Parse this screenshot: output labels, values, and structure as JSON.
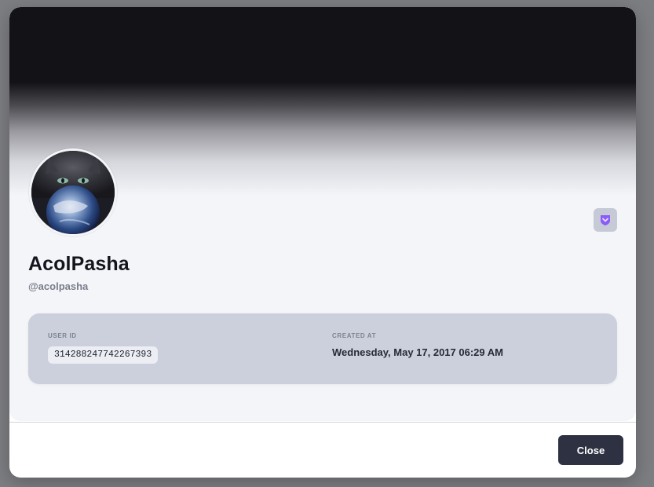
{
  "profile": {
    "display_name": "AcolPasha",
    "handle": "@acolpasha",
    "avatar_icon": "cat-globe-avatar",
    "badge_icon": "shield-chevron-icon"
  },
  "details": {
    "user_id_label": "USER ID",
    "user_id_value": "314288247742267393",
    "created_label": "CREATED AT",
    "created_value": "Wednesday, May 17, 2017 06:29 AM"
  },
  "footer": {
    "close_label": "Close"
  },
  "colors": {
    "overlay": "#7d7e82",
    "card_background": "#f4f5f9",
    "banner_dark": "#131317",
    "info_panel": "#cbd0dc",
    "badge_background": "#c6c9d6",
    "badge_accent": "#8b5cf6",
    "close_button": "#2d3142"
  }
}
